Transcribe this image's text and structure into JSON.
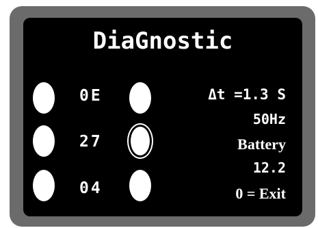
{
  "screen": {
    "title": "DiaGnostic"
  },
  "buttons": {
    "left": [
      {
        "code": "0E"
      },
      {
        "code": "27"
      },
      {
        "code": "04"
      }
    ],
    "middle_selected_index": 1
  },
  "info": {
    "delta_t": "Δt =1.3 S",
    "frequency": "50Hz",
    "source": "Battery",
    "voltage": "12.2",
    "exit_hint": "0 = Exit"
  },
  "colors": {
    "bezel": "#6b6b6b",
    "screen": "#000000",
    "foreground": "#ffffff"
  }
}
